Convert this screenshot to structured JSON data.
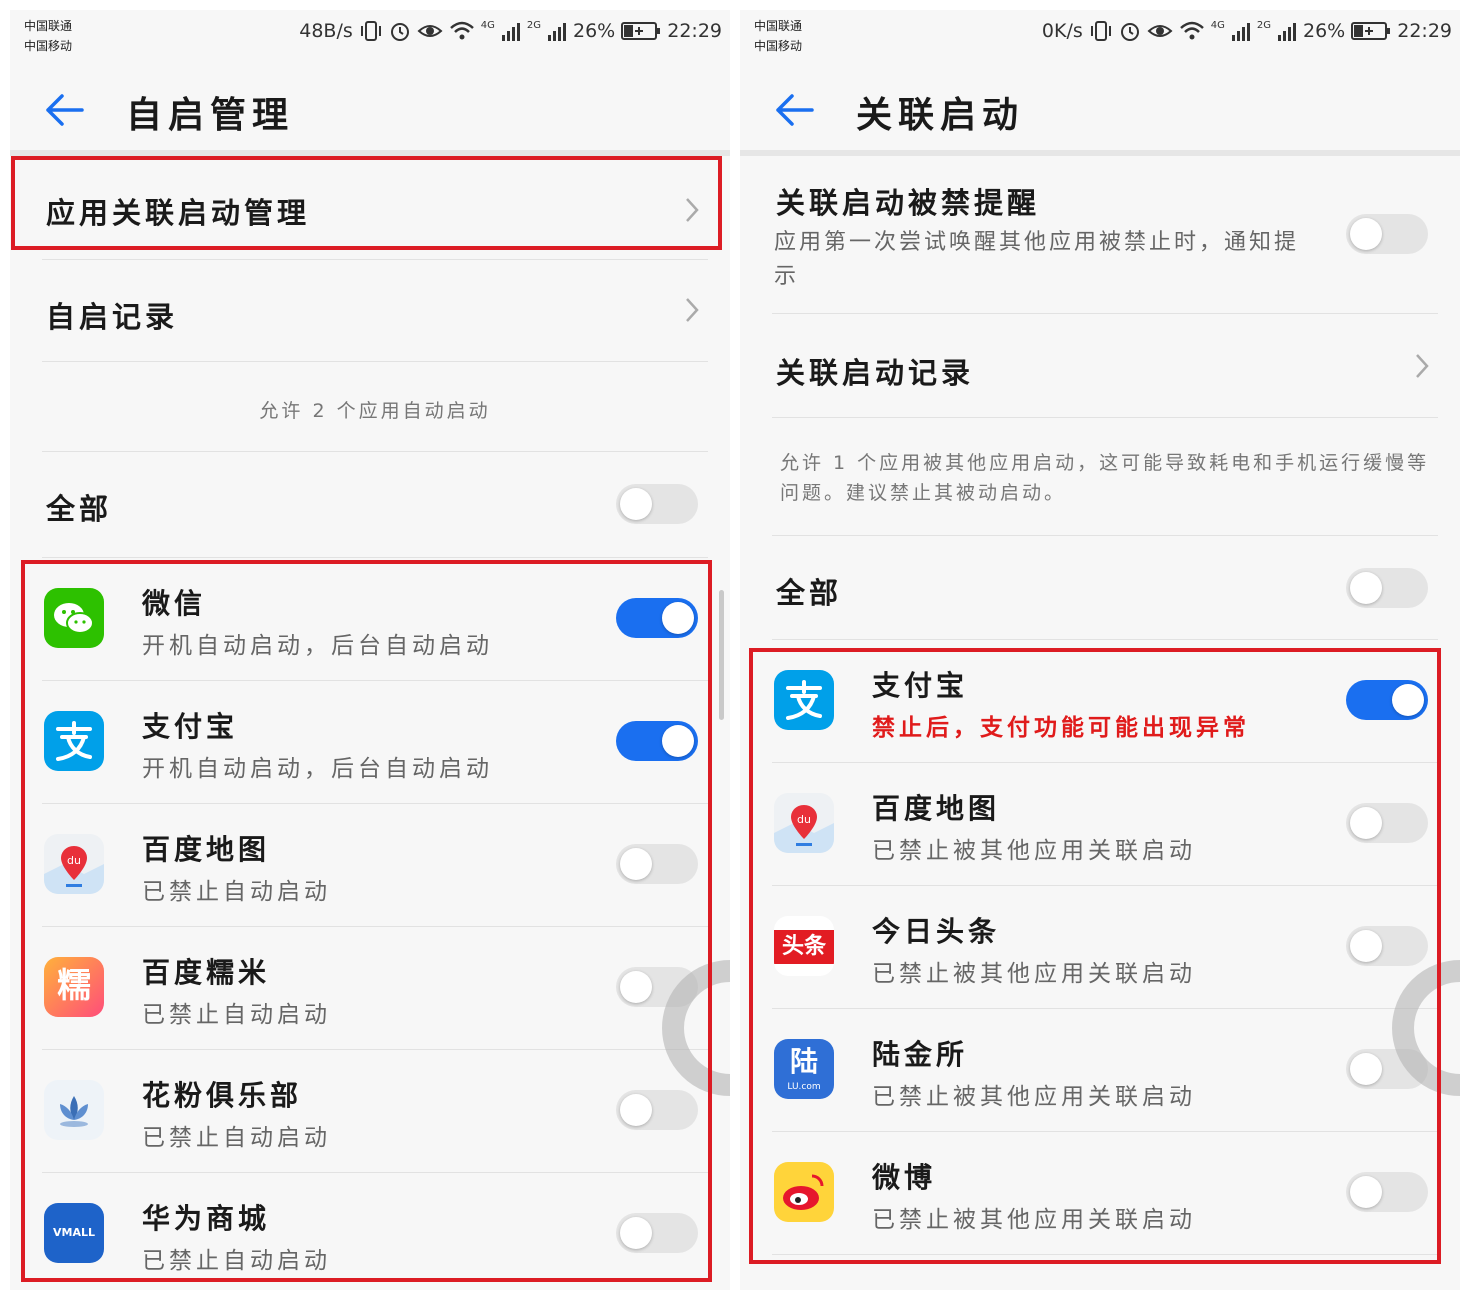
{
  "colors": {
    "accent": "#1a6ff0",
    "highlight": "#dc1c24",
    "warning": "#e01b1b"
  },
  "left": {
    "status": {
      "carrier1": "中国联通",
      "carrier2": "中国移动",
      "speed": "48B/s",
      "net1": "4G",
      "net2": "2G",
      "battery": "26%",
      "time": "22:29"
    },
    "title": "自启管理",
    "menu": [
      {
        "label": "应用关联启动管理"
      },
      {
        "label": "自启记录"
      }
    ],
    "note": "允许 2 个应用自动启动",
    "all_label": "全部",
    "all_on": false,
    "apps": [
      {
        "name": "微信",
        "desc": "开机自动启动，后台自动启动",
        "on": true,
        "icon": "wechat-icon"
      },
      {
        "name": "支付宝",
        "desc": "开机自动启动，后台自动启动",
        "on": true,
        "icon": "alipay-icon"
      },
      {
        "name": "百度地图",
        "desc": "已禁止自动启动",
        "on": false,
        "icon": "baidu-map-icon"
      },
      {
        "name": "百度糯米",
        "desc": "已禁止自动启动",
        "on": false,
        "icon": "baidu-nuomi-icon",
        "icon_text": "糯"
      },
      {
        "name": "花粉俱乐部",
        "desc": "已禁止自动启动",
        "on": false,
        "icon": "huafen-club-icon"
      },
      {
        "name": "华为商城",
        "desc": "已禁止自动启动",
        "on": false,
        "icon": "vmall-icon",
        "icon_text": "VMALL"
      }
    ]
  },
  "right": {
    "status": {
      "carrier1": "中国联通",
      "carrier2": "中国移动",
      "speed": "0K/s",
      "net1": "4G",
      "net2": "2G",
      "battery": "26%",
      "time": "22:29"
    },
    "title": "关联启动",
    "reminder": {
      "title": "关联启动被禁提醒",
      "desc": "应用第一次尝试唤醒其他应用被禁止时，通知提示",
      "on": false
    },
    "record_label": "关联启动记录",
    "note": "允许 1 个应用被其他应用启动，这可能导致耗电和手机运行缓慢等问题。建议禁止其被动启动。",
    "all_label": "全部",
    "all_on": false,
    "apps": [
      {
        "name": "支付宝",
        "desc": "禁止后，支付功能可能出现异常",
        "on": true,
        "warn": true,
        "icon": "alipay-icon"
      },
      {
        "name": "百度地图",
        "desc": "已禁止被其他应用关联启动",
        "on": false,
        "icon": "baidu-map-icon"
      },
      {
        "name": "今日头条",
        "desc": "已禁止被其他应用关联启动",
        "on": false,
        "icon": "toutiao-icon",
        "icon_text": "头条"
      },
      {
        "name": "陆金所",
        "desc": "已禁止被其他应用关联启动",
        "on": false,
        "icon": "lufax-icon",
        "icon_text": "陆",
        "icon_sub": "LU.com"
      },
      {
        "name": "微博",
        "desc": "已禁止被其他应用关联启动",
        "on": false,
        "icon": "weibo-icon"
      }
    ]
  }
}
